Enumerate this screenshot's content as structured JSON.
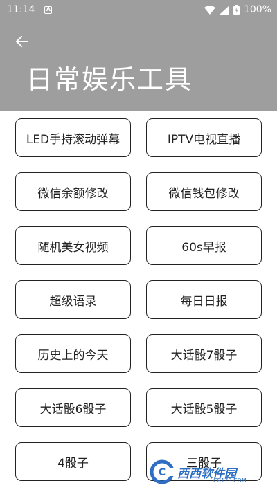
{
  "status_bar": {
    "time": "11:14",
    "notification_icon": "a-notification-icon",
    "battery": "100%"
  },
  "header": {
    "back_icon": "arrow-left-icon",
    "title": "日常娱乐工具"
  },
  "tools": [
    {
      "label": "LED手持滚动弹幕"
    },
    {
      "label": "IPTV电视直播"
    },
    {
      "label": "微信余额修改"
    },
    {
      "label": "微信钱包修改"
    },
    {
      "label": "随机美女视频"
    },
    {
      "label": "60s早报"
    },
    {
      "label": "超级语录"
    },
    {
      "label": "每日日报"
    },
    {
      "label": "历史上的今天"
    },
    {
      "label": "大话骰7骰子"
    },
    {
      "label": "大话骰6骰子"
    },
    {
      "label": "大话骰5骰子"
    },
    {
      "label": "4骰子"
    },
    {
      "label": "三骰子"
    }
  ],
  "watermark": {
    "text": "西西软件园",
    "sub": "CR173.COM",
    "logo_letter": "C"
  },
  "colors": {
    "header_bg": "#9e9e9e",
    "button_border": "#222222",
    "watermark": "#2e6fc4"
  }
}
